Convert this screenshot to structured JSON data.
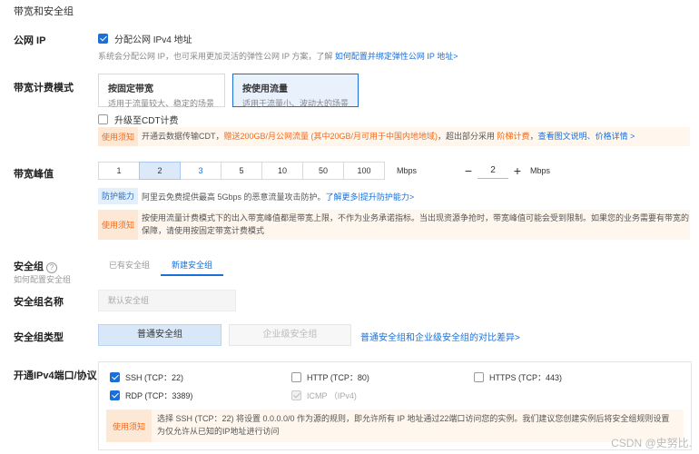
{
  "section_title": "带宽和安全组",
  "public_ip": {
    "label": "公网 IP",
    "checkbox_label": "分配公网 IPv4 地址",
    "hint": "系统会分配公网 IP，也可采用更加灵活的弹性公网 IP 方案，了解 ",
    "hint_link": "如何配置并绑定弹性公网 IP 地址>"
  },
  "billing": {
    "label": "带宽计费模式",
    "options": [
      {
        "title": "按固定带宽",
        "desc": "适用于流量较大、稳定的场景"
      },
      {
        "title": "按使用流量",
        "desc": "适用于流量小、波动大的场景"
      }
    ],
    "selected_index": 1,
    "cdt_label": "升级至CDT计费",
    "notice_tag": "使用须知",
    "notice_prefix": "开通云数据传输CDT，",
    "notice_highlight": "赠送200GB/月公网流量 (其中20GB/月可用于中国内地地域)",
    "notice_mid": "，超出部分采用 ",
    "notice_link1": "阶梯计费",
    "notice_sep": "，",
    "notice_link2": "查看图文说明、价格详情 >"
  },
  "peak": {
    "label": "带宽峰值",
    "options": [
      "1",
      "2",
      "3",
      "5",
      "10",
      "50",
      "100"
    ],
    "selected": "2",
    "unit": "Mbps",
    "stepper_minus": "−",
    "stepper_value": "2",
    "stepper_plus": "+",
    "stepper_unit": "Mbps",
    "protect_tag": "防护能力",
    "protect_text": "阿里云免费提供最高 5Gbps 的恶意流量攻击防护。",
    "protect_link1": "了解更多",
    "protect_sep": " | ",
    "protect_link2": "提升防护能力>",
    "notice_tag": "使用须知",
    "notice_line1": "按使用流量计费模式下的出入带宽峰值都是带宽上限，不作为业务承诺指标。当出现资源争抢时，带宽峰值可能会受到限制。如果您的业务需要有带宽的",
    "notice_line2": "保障，请使用按固定带宽计费模式"
  },
  "security_group": {
    "label": "安全组",
    "help": "?",
    "sub_label": "如何配置安全组",
    "tabs": [
      "已有安全组",
      "新建安全组"
    ],
    "active_tab": 1,
    "name_label": "安全组名称",
    "name_placeholder": "默认安全组",
    "type_label": "安全组类型",
    "types": [
      "普通安全组",
      "企业级安全组"
    ],
    "type_link": "普通安全组和企业级安全组的对比差异>"
  },
  "ports": {
    "label": "开通IPv4端口/协议",
    "items": [
      {
        "label": "SSH (TCP：22)",
        "checked": true
      },
      {
        "label": "HTTP (TCP：80)",
        "checked": false
      },
      {
        "label": "HTTPS (TCP：443)",
        "checked": false
      },
      {
        "label": "RDP (TCP：3389)",
        "checked": true
      },
      {
        "label": "ICMP （IPv4)",
        "checked": true,
        "disabled": true
      }
    ],
    "notice_tag": "使用须知",
    "notice_line1": "选择 SSH (TCP：22) 将设置 0.0.0.0/0 作为源的规则，即允许所有 IP 地址通过22端口访问您的实例。我们建议您创建实例后将安全组规则设置",
    "notice_line2": "为仅允许从已知的IP地址进行访问"
  },
  "watermark": "CSDN @史努比."
}
